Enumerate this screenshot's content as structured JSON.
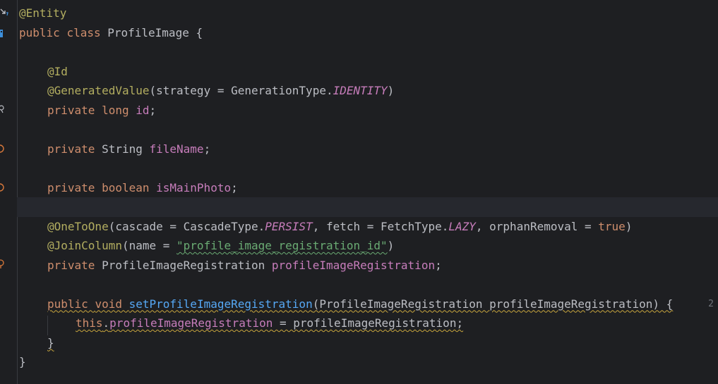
{
  "code": {
    "l1": [
      "@Entity"
    ],
    "l2": [
      "public ",
      "class ",
      "ProfileImage {"
    ],
    "l3": [],
    "l4": [
      "@Id"
    ],
    "l5": [
      "@GeneratedValue",
      "(strategy = GenerationType.",
      "IDENTITY",
      ")"
    ],
    "l6": [
      "private ",
      "long ",
      "id",
      ";"
    ],
    "l7": [],
    "l8": [
      "private ",
      "String ",
      "fileName",
      ";"
    ],
    "l9": [],
    "l10": [
      "private ",
      "boolean ",
      "isMainPhoto",
      ";"
    ],
    "l11": [],
    "l12": [
      "@OneToOne",
      "(cascade = CascadeType.",
      "PERSIST",
      ", fetch = FetchType.",
      "LAZY",
      ", orphanRemoval = ",
      "true",
      ")"
    ],
    "l13": [
      "@JoinColumn",
      "(name = ",
      "\"profile_image_registration_id\"",
      ")"
    ],
    "l14": [
      "private ",
      "ProfileImageRegistration ",
      "profileImageRegistration",
      ";"
    ],
    "l15": [],
    "l16": [
      "public ",
      "void ",
      "setProfileImageRegistration",
      "(ProfileImageRegistration profileImageRegistration) {"
    ],
    "l17": [
      "this",
      ".",
      "profileImageRegistration",
      " = profileImageRegistration;"
    ],
    "l18": [
      "}"
    ],
    "l19": [
      "}"
    ]
  },
  "hints": {
    "usages": "2"
  },
  "gutter_icons": [
    "bean-icon",
    "database-icon",
    "key-icon",
    "field-icon",
    "field-icon",
    "relation-icon"
  ],
  "colors": {
    "background": "#1e1f22",
    "keyword": "#cf8e6d",
    "annotation": "#b3ae60",
    "field": "#c77dbb",
    "method": "#56a8f5",
    "string": "#6aab73",
    "text": "#bcbec4"
  }
}
